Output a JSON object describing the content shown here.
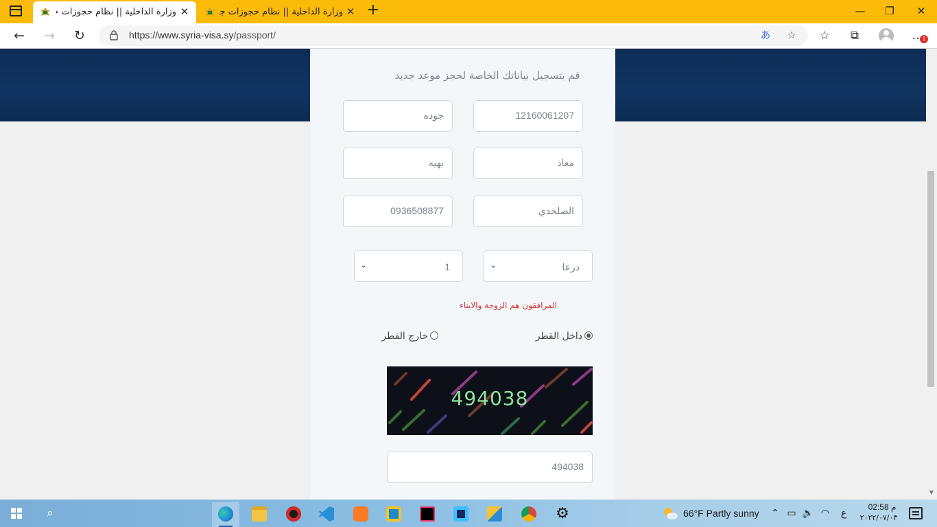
{
  "browser": {
    "tabs": [
      {
        "title": "وزارة الداخلية || نظام حجوزات جوازا",
        "active": true
      },
      {
        "title": "وزارة الداخلية || نظام حجوزات جوازا",
        "active": false
      }
    ],
    "new_tab": "+",
    "url_prefix": "https://www.syria-visa.sy",
    "url_path": "/passport/",
    "window_controls": {
      "minimize": "—",
      "restore": "❐",
      "close": "✕"
    },
    "notification_count": "1"
  },
  "form": {
    "heading": "قم بتسجيل بياناتك الخاصة لحجز موعد جديد",
    "national_id": "12160061207",
    "last_name_field": "جوده",
    "first_name": "معاذ",
    "mother_name": "بهيه",
    "family_name": "الصلخدي",
    "phone": "0936508877",
    "governorate": "درعا",
    "companions_count": "1",
    "companions_note": "المرافقون هم الزوجة والابناء",
    "location_options": [
      {
        "label": "داخل القطر",
        "selected": true
      },
      {
        "label": "خارج القطر",
        "selected": false
      }
    ],
    "captcha_code": "494038",
    "captcha_input": "494038"
  },
  "taskbar": {
    "weather": "66°F  Partly sunny",
    "input_language": "ع",
    "time": "02:58 م",
    "date": "٢٠٢٢/٠٧/٠٣"
  },
  "colors": {
    "tabbar": "#fbbb08",
    "hero": "#103462",
    "note": "#d62d2d",
    "captcha_bg": "#0e1019",
    "captcha_text": "#8ce59a"
  }
}
